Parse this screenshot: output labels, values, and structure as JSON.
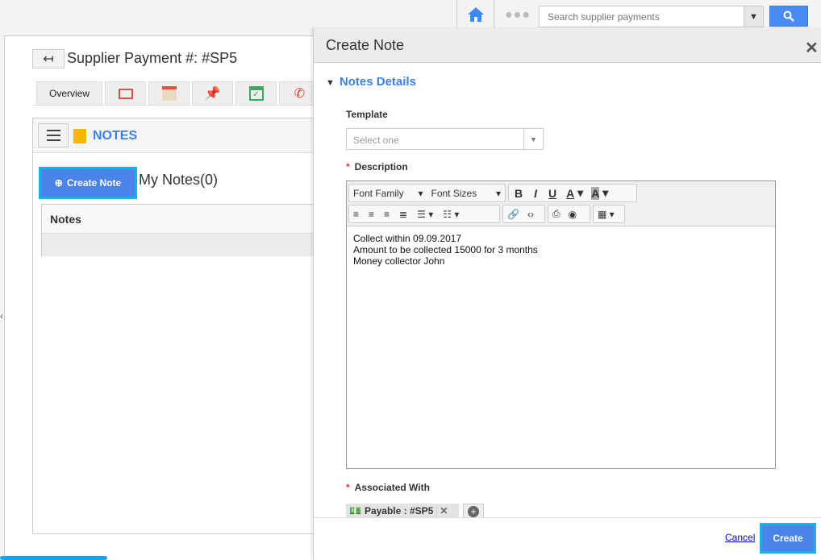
{
  "header": {
    "search_placeholder": "Search supplier payments",
    "more_label": "●●●"
  },
  "page": {
    "title": "Supplier Payment #: #SP5",
    "back_label": "↤",
    "tabs": [
      {
        "label": "Overview"
      },
      {
        "icon": "list-icon"
      },
      {
        "icon": "calendar-icon"
      },
      {
        "icon": "pin-icon"
      },
      {
        "icon": "calendar-check-icon"
      },
      {
        "icon": "phone-icon"
      }
    ]
  },
  "notes_panel": {
    "title": "NOTES",
    "create_button": "Create Note",
    "my_notes": "My Notes(0)",
    "table_header": "Notes"
  },
  "modal": {
    "title": "Create Note",
    "close": "✕",
    "section": "Notes Details",
    "template": {
      "label": "Template",
      "placeholder": "Select one"
    },
    "description": {
      "label": "Description",
      "required": "*",
      "lines": [
        "Collect within 09.09.2017",
        "Amount to be collected 15000 for 3 months",
        "Money collector John"
      ]
    },
    "toolbar": {
      "font_family": "Font Family",
      "font_sizes": "Font Sizes",
      "bold": "B",
      "italic": "I",
      "underline": "U",
      "font_color": "A",
      "bg_color": "A"
    },
    "associated": {
      "label": "Associated With",
      "required": "*",
      "chip": "Payable : #SP5",
      "chip_remove": "✕"
    },
    "cancel": "Cancel",
    "create": "Create"
  },
  "colors": {
    "accent": "#3d7fe0",
    "button": "#4a84ea",
    "focus": "#12b4e6"
  }
}
